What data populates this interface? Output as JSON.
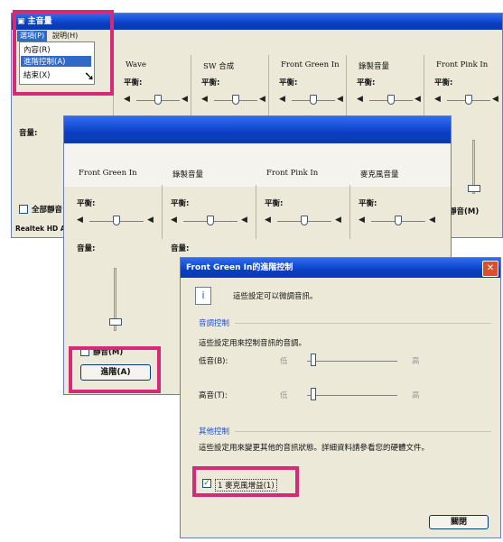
{
  "main_window": {
    "title": "主音量",
    "menu": {
      "options": "選項(P)",
      "help": "說明(H)"
    },
    "options_menu_items": [
      "內容(R)",
      "進階控制(A)",
      "結束(X)"
    ],
    "columns": [
      "Wave",
      "SW 合成",
      "Front Green In",
      "錄製音量",
      "Front Pink In"
    ],
    "balance_label": "平衡:",
    "volume_label": "音量:",
    "mute_all_label": "全部靜音",
    "status_text": "Realtek HD Au"
  },
  "middle_window": {
    "columns": [
      "Front Green In",
      "錄製音量",
      "Front Pink In",
      "麥克風音量"
    ],
    "balance_label": "平衡:",
    "volume_label": "音量:",
    "mute_label": "靜音(M)",
    "advanced_button": "進階(A)",
    "right_mute_label": "靜音(M)"
  },
  "dialog": {
    "title": "Front Green In的進階控制",
    "info_text": "這些設定可以微調音訊。",
    "tone_group": "音調控制",
    "tone_desc": "這些設定用來控制音訊的音調。",
    "bass_label": "低音(B):",
    "treble_label": "高音(T):",
    "low_mark": "低",
    "high_mark": "高",
    "other_group": "其他控制",
    "other_desc": "這些設定用來變更其他的音訊狀態。詳細資料請參看您的硬體文件。",
    "mic_boost_label": "1 麥克風增益(1)",
    "close_button": "關閉"
  },
  "colors": {
    "highlight": "#d42a78",
    "titlebar": "#0a3fc4"
  },
  "icons": [
    "speaker-left-icon",
    "speaker-right-icon",
    "info-icon",
    "close-icon",
    "cursor-icon"
  ]
}
